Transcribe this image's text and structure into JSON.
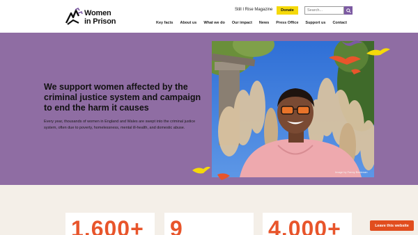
{
  "header": {
    "logo_line1": "Women",
    "logo_line2": "in Prison",
    "magazine_link": "Still I Rise Magazine",
    "donate_label": "Donate",
    "search_placeholder": "Search...",
    "nav": [
      {
        "label": "Key facts"
      },
      {
        "label": "About us"
      },
      {
        "label": "What we do"
      },
      {
        "label": "Our impact"
      },
      {
        "label": "News"
      },
      {
        "label": "Press Office"
      },
      {
        "label": "Support us"
      },
      {
        "label": "Contact"
      }
    ]
  },
  "hero": {
    "title": "We support women affected by the criminal justice system and campaign to end the harm it causes",
    "body": "Every year, thousands of women in England and Wales are swept into the criminal justice system, often due to poverty, homelessness, mental ill-health, and domestic abuse.",
    "photo_credit": "Image by Fanny Beckman"
  },
  "stats": [
    {
      "value": "1,600+"
    },
    {
      "value": "9"
    },
    {
      "value": "4,000+"
    }
  ],
  "leave_button": "Leave this website",
  "colors": {
    "hero_bg": "#8f6da3",
    "accent_orange": "#e8552b",
    "donate_yellow": "#f5d90a",
    "brand_purple": "#7c5aa2",
    "stats_bg": "#f4efe8"
  },
  "icons": {
    "logo": "women-in-prison-logo-icon",
    "search": "search-icon"
  }
}
